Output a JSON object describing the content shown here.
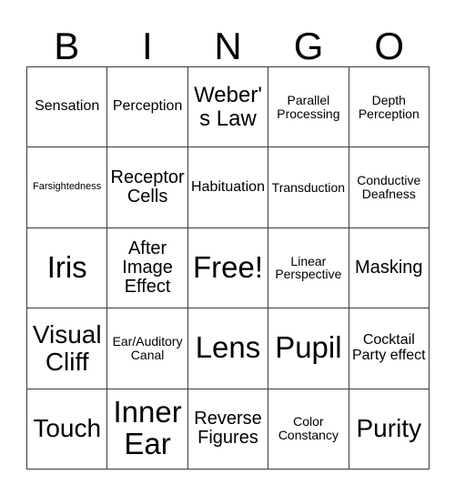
{
  "card": {
    "header_letters": [
      "B",
      "I",
      "N",
      "G",
      "O"
    ],
    "rows": [
      [
        {
          "label": "Sensation",
          "size": "sm"
        },
        {
          "label": "Perception",
          "size": "sm"
        },
        {
          "label": "Weber's Law",
          "size": "lg"
        },
        {
          "label": "Parallel Processing",
          "size": "xs"
        },
        {
          "label": "Depth Perception",
          "size": "xs"
        }
      ],
      [
        {
          "label": "Farsightedness",
          "size": "xxs"
        },
        {
          "label": "Receptor Cells",
          "size": "md"
        },
        {
          "label": "Habituation",
          "size": "sm"
        },
        {
          "label": "Transduction",
          "size": "xs"
        },
        {
          "label": "Conductive Deafness",
          "size": "xs"
        }
      ],
      [
        {
          "label": "Iris",
          "size": "xxl"
        },
        {
          "label": "After Image Effect",
          "size": "md"
        },
        {
          "label": "Free!",
          "size": "xxl"
        },
        {
          "label": "Linear Perspective",
          "size": "xs"
        },
        {
          "label": "Masking",
          "size": "md"
        }
      ],
      [
        {
          "label": "Visual Cliff",
          "size": "xl"
        },
        {
          "label": "Ear/Auditory Canal",
          "size": "xs"
        },
        {
          "label": "Lens",
          "size": "xxl"
        },
        {
          "label": "Pupil",
          "size": "xxl"
        },
        {
          "label": "Cocktail Party effect",
          "size": "sm"
        }
      ],
      [
        {
          "label": "Touch",
          "size": "xl"
        },
        {
          "label": "Inner Ear",
          "size": "xxl"
        },
        {
          "label": "Reverse Figures",
          "size": "md"
        },
        {
          "label": "Color Constancy",
          "size": "xs"
        },
        {
          "label": "Purity",
          "size": "xl"
        }
      ]
    ],
    "free_space": {
      "row": 2,
      "col": 2,
      "label": "Free!"
    },
    "colors": {
      "background": "#ffffff",
      "text": "#000000",
      "grid_line": "#3a3a3a"
    }
  }
}
